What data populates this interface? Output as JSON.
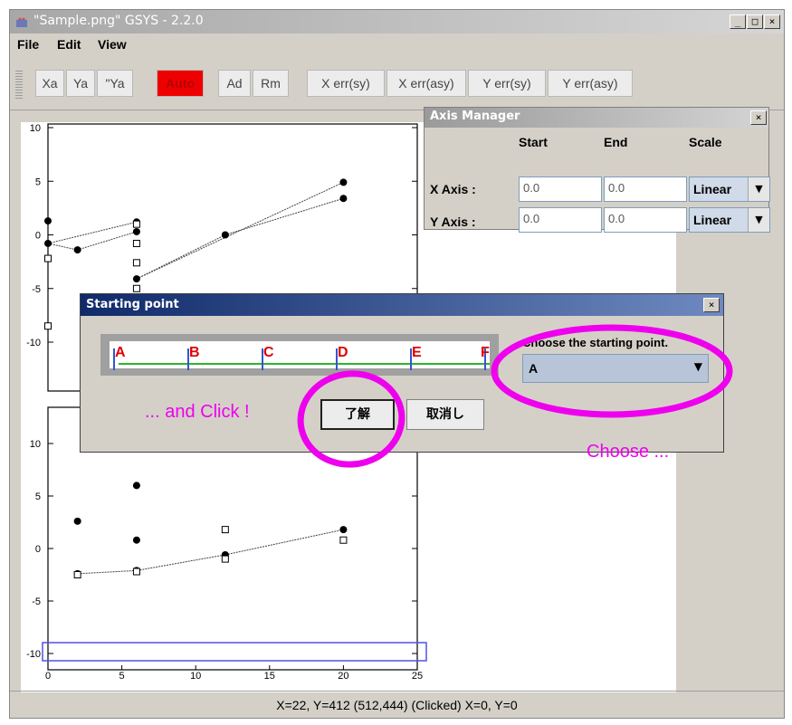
{
  "window": {
    "title": "\"Sample.png\" GSYS - 2.2.0",
    "controls": [
      "_",
      "□",
      "×"
    ]
  },
  "menu": [
    "File",
    "Edit",
    "View"
  ],
  "toolbar": {
    "buttons": [
      "Xa",
      "Ya",
      "\"Ya",
      "Auto",
      "Ad",
      "Rm",
      "X err(sy)",
      "X err(asy)",
      "Y err(sy)",
      "Y err(asy)"
    ],
    "active": "Auto"
  },
  "axis_manager": {
    "title": "Axis Manager",
    "close": "×",
    "headers": [
      "Start",
      "End",
      "Scale"
    ],
    "rows": [
      {
        "label": "X Axis :",
        "start": "0.0",
        "end": "0.0",
        "scale": "Linear"
      },
      {
        "label": "Y Axis :",
        "start": "0.0",
        "end": "0.0",
        "scale": "Linear"
      }
    ]
  },
  "dialog": {
    "title": "Starting point",
    "close": "×",
    "points": [
      "A",
      "B",
      "C",
      "D",
      "E",
      "F"
    ],
    "choose_label": "Choose the starting point.",
    "selected": "A",
    "ok_label": "了解",
    "cancel_label": "取消し"
  },
  "annotations": {
    "click": "... and Click !",
    "choose": "Choose ..."
  },
  "status": {
    "text": "X=22, Y=412 (512,444)      (Clicked) X=0, Y=0"
  },
  "chart_data": [
    {
      "type": "scatter",
      "title": "",
      "xlabel": "",
      "ylabel": "",
      "ylim": [
        -10,
        10
      ],
      "y_ticks": [
        "10",
        "5",
        "0",
        "-5",
        "-10"
      ],
      "series": [
        {
          "marker": "filled",
          "x": [
            0,
            0,
            2,
            6,
            6,
            6,
            12,
            20,
            20
          ],
          "y": [
            1.3,
            -0.8,
            -1.4,
            1.2,
            0.3,
            -4.1,
            0.0,
            4.9,
            3.4
          ]
        },
        {
          "marker": "open",
          "x": [
            0,
            0,
            6,
            6,
            6,
            6
          ],
          "y": [
            -2.2,
            -8.5,
            1.0,
            -0.8,
            -2.6,
            -5.0
          ]
        }
      ]
    },
    {
      "type": "scatter",
      "title": "",
      "xlabel": "",
      "ylabel": "",
      "xlim": [
        0,
        25
      ],
      "ylim": [
        -10,
        10
      ],
      "x_ticks": [
        "0",
        "5",
        "10",
        "15",
        "20",
        "25"
      ],
      "y_ticks": [
        "10",
        "5",
        "0",
        "-5",
        "-10"
      ],
      "series": [
        {
          "marker": "filled",
          "x": [
            2,
            2,
            6,
            6,
            6,
            12,
            20
          ],
          "y": [
            2.6,
            -2.4,
            6.0,
            0.8,
            -2.1,
            -0.6,
            1.8
          ]
        },
        {
          "marker": "open",
          "x": [
            2,
            6,
            12,
            12,
            20
          ],
          "y": [
            -2.5,
            -2.2,
            1.8,
            -1.0,
            0.8
          ]
        }
      ]
    }
  ]
}
